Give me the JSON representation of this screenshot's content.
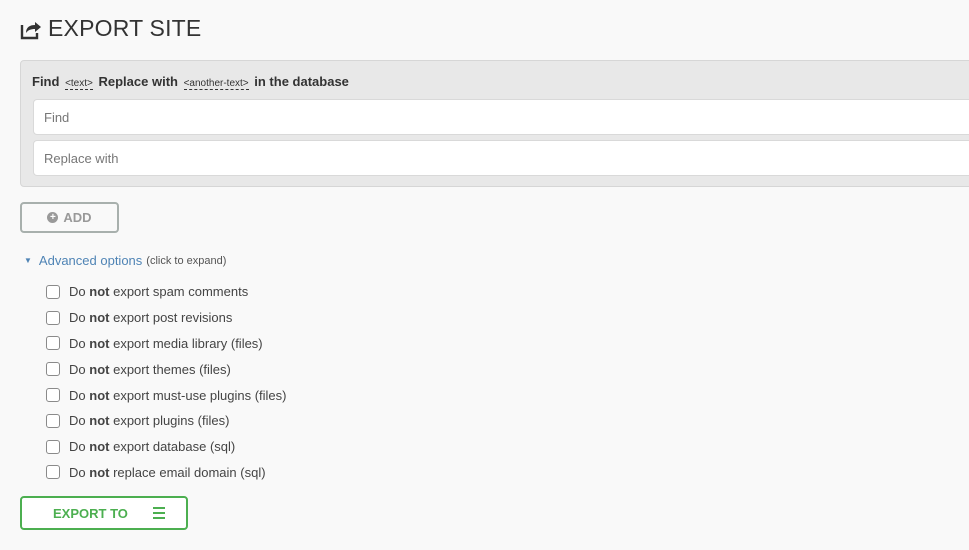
{
  "header": {
    "icon": "share-export-icon",
    "title": "EXPORT SITE"
  },
  "find_replace": {
    "heading_find": "Find",
    "heading_text_tag": "<text>",
    "heading_replace": "Replace with",
    "heading_another_tag": "<another-text>",
    "heading_suffix": "in the database",
    "find_placeholder": "Find",
    "find_value": "",
    "replace_placeholder": "Replace with",
    "replace_value": ""
  },
  "add_button": {
    "icon": "plus-circle-icon",
    "label": "ADD"
  },
  "advanced": {
    "icon": "triangle-down-icon",
    "link_label": "Advanced options",
    "hint": "(click to expand)",
    "options": [
      {
        "prefix": "Do",
        "bold": "not",
        "rest": "export spam comments",
        "checked": false
      },
      {
        "prefix": "Do",
        "bold": "not",
        "rest": "export post revisions",
        "checked": false
      },
      {
        "prefix": "Do",
        "bold": "not",
        "rest": "export media library (files)",
        "checked": false
      },
      {
        "prefix": "Do",
        "bold": "not",
        "rest": "export themes (files)",
        "checked": false
      },
      {
        "prefix": "Do",
        "bold": "not",
        "rest": "export must-use plugins (files)",
        "checked": false
      },
      {
        "prefix": "Do",
        "bold": "not",
        "rest": "export plugins (files)",
        "checked": false
      },
      {
        "prefix": "Do",
        "bold": "not",
        "rest": "export database (sql)",
        "checked": false
      },
      {
        "prefix": "Do",
        "bold": "not",
        "rest": "replace email domain (sql)",
        "checked": false
      }
    ]
  },
  "export_button": {
    "label": "EXPORT TO",
    "icon": "hamburger-menu-icon",
    "color": "#4caf50"
  }
}
